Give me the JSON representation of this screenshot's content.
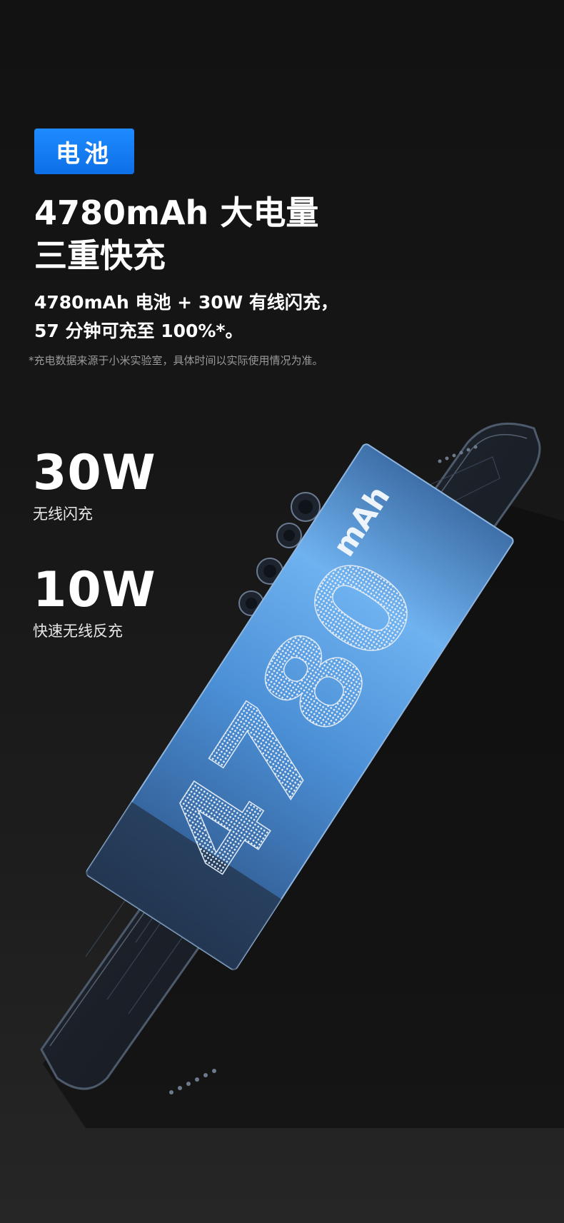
{
  "badge": "电池",
  "title": [
    "4780mAh 大电量",
    "三重快充"
  ],
  "subtitle": [
    "4780mAh 电池 + 30W 有线闪充，",
    "57 分钟可充至 100%*。"
  ],
  "footnote": "*充电数据来源于小米实验室，具体时间以实际使用情况为准。",
  "specs": [
    {
      "value": "30W",
      "label": "无线闪充"
    },
    {
      "value": "10W",
      "label": "快速无线反充"
    }
  ],
  "phone_battery": {
    "capacity": "4780",
    "unit": "mAh"
  },
  "colors": {
    "badge": "#1a82f7",
    "background": "#151515",
    "battery_glow": "#4a8fd8"
  }
}
